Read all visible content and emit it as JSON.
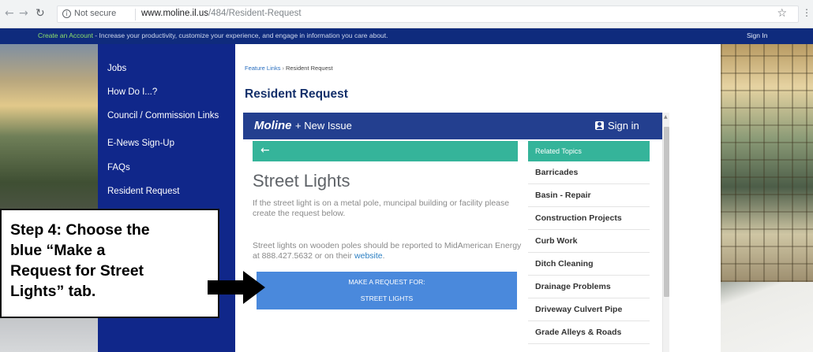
{
  "browser": {
    "security_label": "Not secure",
    "url_host": "www.moline.il.us",
    "url_path": "/484/Resident-Request"
  },
  "site_bar": {
    "create_account_link": "Create an Account",
    "tagline": " - Increase your productivity, customize your experience, and engage in information you care about.",
    "sign_in": "Sign In"
  },
  "sidebar": {
    "items": [
      {
        "label": "Jobs"
      },
      {
        "label": "How Do I...?"
      },
      {
        "label": "Council / Commission Links"
      },
      {
        "label": "E-News Sign-Up"
      },
      {
        "label": "FAQs"
      },
      {
        "label": "Resident Request"
      }
    ]
  },
  "breadcrumb": {
    "parent": "Feature Links",
    "separator": "›",
    "current": "Resident Request"
  },
  "page": {
    "title": "Resident Request"
  },
  "app": {
    "brand": "Moline",
    "new_issue": "+ New Issue",
    "sign_in": "Sign in",
    "back_icon": "arrow-left-icon",
    "title": "Street Lights",
    "desc1": "If the street light is on a metal pole, muncipal building or facility please create the request below.",
    "desc2_prefix": "Street lights on wooden poles should be reported to MidAmerican Energy at 888.427.5632 or on their ",
    "desc2_link": "website",
    "desc2_suffix": ".",
    "request_button": {
      "line1": "MAKE A REQUEST FOR:",
      "line2": "STREET LIGHTS"
    },
    "related": {
      "heading": "Related Topics",
      "items": [
        "Barricades",
        "Basin - Repair",
        "Construction Projects",
        "Curb Work",
        "Ditch Cleaning",
        "Drainage Problems",
        "Driveway Culvert Pipe",
        "Grade Alleys & Roads"
      ]
    }
  },
  "annotation": {
    "text": "Step 4: Choose the\nblue “Make a\nRequest for Street\nLights” tab."
  },
  "colors": {
    "site_bar": "#0f2b7d",
    "nav_bg": "#10278a",
    "app_header": "#233f8f",
    "teal": "#35b49a",
    "request_button": "#4a89dc"
  }
}
